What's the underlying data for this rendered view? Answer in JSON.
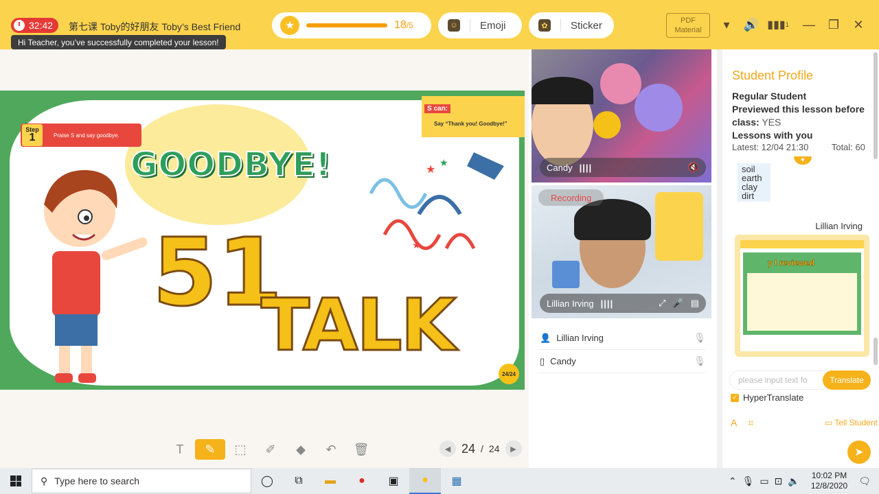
{
  "topbar": {
    "timer": "32:42",
    "lesson_title": "第七课 Toby的好朋友 Toby’s Best Friend",
    "toast": "Hi Teacher, you’ve successfully completed your lesson!",
    "progress_count": "18",
    "progress_total": "/5",
    "emoji_label": "Emoji",
    "sticker_label": "Sticker",
    "pdf_line1": "PDF",
    "pdf_line2": "Material",
    "signal_num": "1"
  },
  "slide": {
    "step_label": "Step",
    "step_num": "1",
    "step_text": "Praise S and say goodbye.",
    "scan_label": "S can:",
    "scan_text": "Say “Thank you! Goodbye!”",
    "goodbye": "GOODBYE!",
    "num": "51",
    "talk": "TALK",
    "page_badge": "24/24"
  },
  "pager": {
    "current": "24",
    "total": "24",
    "sep": "/"
  },
  "videos": {
    "student_name": "Candy",
    "teacher_name": "Lillian Irving",
    "recording": "Recording"
  },
  "members": [
    {
      "name": "Lillian Irving"
    },
    {
      "name": "Candy"
    }
  ],
  "profile": {
    "title": "Student Profile",
    "regular": "Regular Student",
    "previewed": "Previewed this lesson before",
    "class_label": "class:",
    "class_value": "YES",
    "lessons_with_you": "Lessons with you",
    "latest": "Latest: 12/04 21:30",
    "total": "Total: 60",
    "vocab": [
      "soil",
      "earth",
      "clay",
      "dirt"
    ],
    "sender": "Lillian Irving",
    "thumb_title": "y I reviewed"
  },
  "translate": {
    "placeholder": "please input text fo",
    "button": "Translate",
    "hyper": "HyperTranslate",
    "tell": "Tell Student"
  },
  "taskbar": {
    "search_placeholder": "Type here to search",
    "time": "10:02 PM",
    "date": "12/8/2020"
  }
}
